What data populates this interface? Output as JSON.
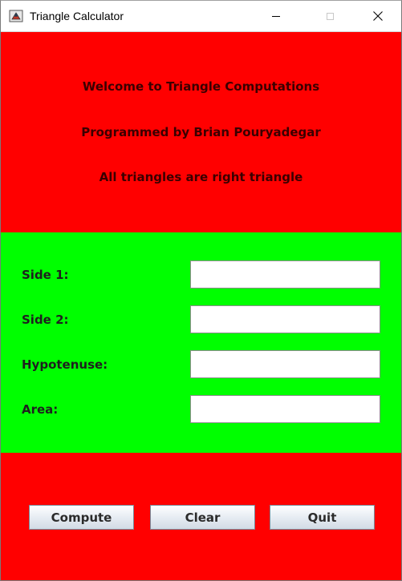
{
  "window": {
    "title": "Triangle Calculator"
  },
  "header": {
    "line1": "Welcome to Triangle Computations",
    "line2": "Programmed by Brian Pouryadegar",
    "line3": "All triangles are right triangle"
  },
  "form": {
    "side1": {
      "label": "Side 1:",
      "value": ""
    },
    "side2": {
      "label": "Side 2:",
      "value": ""
    },
    "hypotenuse": {
      "label": "Hypotenuse:",
      "value": ""
    },
    "area": {
      "label": "Area:",
      "value": ""
    }
  },
  "buttons": {
    "compute": "Compute",
    "clear": "Clear",
    "quit": "Quit"
  },
  "colors": {
    "top_panel": "#ff0000",
    "middle_panel": "#00ff00",
    "bottom_panel": "#ff0000"
  },
  "icons": {
    "app": "java-app-icon",
    "minimize": "minimize-icon",
    "maximize": "maximize-icon",
    "close": "close-icon"
  }
}
